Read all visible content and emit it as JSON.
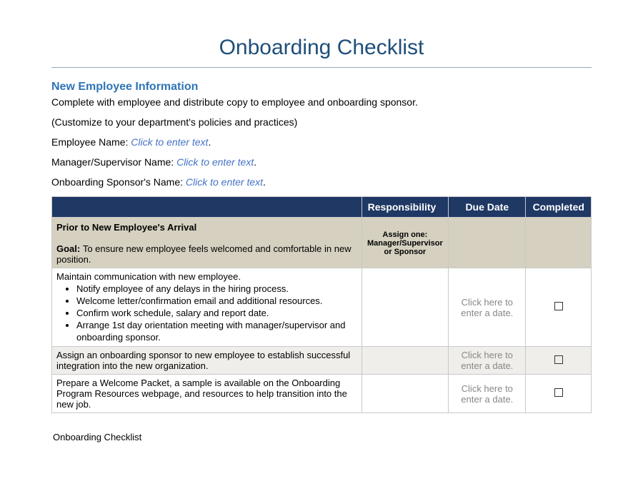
{
  "title": "Onboarding Checklist",
  "section_heading": "New Employee Information",
  "intro_line": "Complete with employee and distribute copy to employee and onboarding sponsor.",
  "customize_line": "(Customize to your department's policies and practices)",
  "fields": {
    "employee_label": "Employee Name: ",
    "manager_label": "Manager/Supervisor Name: ",
    "sponsor_label": "Onboarding Sponsor's Name: ",
    "placeholder": "Click to enter text",
    "period": "."
  },
  "table": {
    "headers": {
      "blank": "",
      "responsibility": "Responsibility",
      "due_date": "Due Date",
      "completed": "Completed"
    },
    "group": {
      "title": "Prior to New Employee's Arrival",
      "goal_label": "Goal: ",
      "goal_text": "To ensure new employee feels welcomed and comfortable in new position.",
      "resp_note": "Assign one: Manager/Supervisor or Sponsor"
    },
    "date_placeholder": "Click here to enter a date.",
    "rows": [
      {
        "lead": "Maintain communication with new employee.",
        "bullets": [
          "Notify employee of any delays in the hiring process.",
          "Welcome letter/confirmation email and additional resources.",
          "Confirm work schedule, salary and report date.",
          "Arrange 1st day orientation meeting with manager/supervisor and onboarding sponsor."
        ],
        "alt": false
      },
      {
        "lead": "Assign an onboarding sponsor to new employee to establish successful integration into the new organization.",
        "bullets": [],
        "alt": true
      },
      {
        "lead": "Prepare a Welcome Packet, a sample is available on the Onboarding Program Resources webpage, and resources to help transition into the new job.",
        "bullets": [],
        "alt": false
      }
    ]
  },
  "footer": "Onboarding Checklist"
}
